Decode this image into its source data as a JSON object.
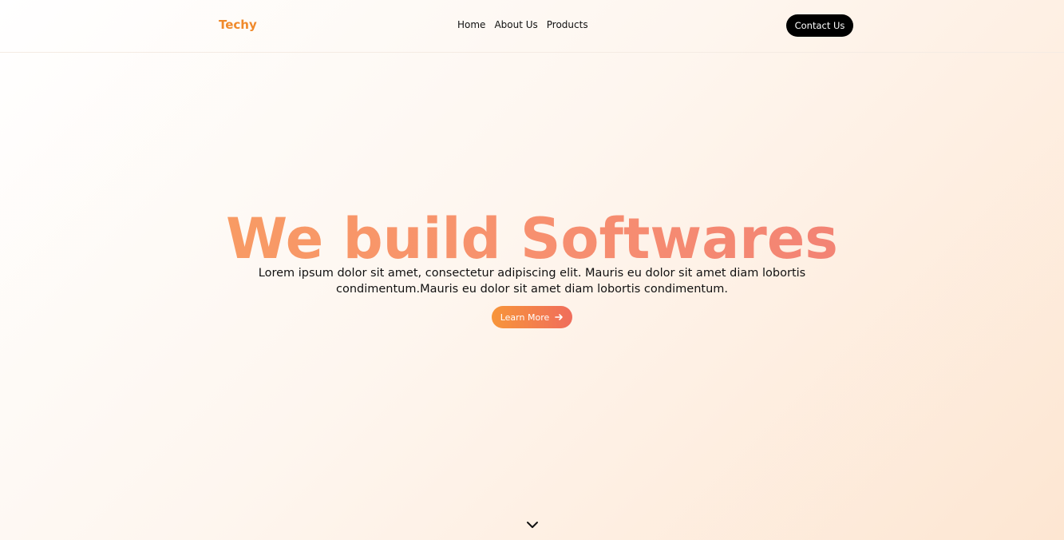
{
  "header": {
    "brand": "Techy",
    "nav": [
      {
        "label": "Home"
      },
      {
        "label": "About Us"
      },
      {
        "label": "Products"
      }
    ],
    "contact_label": "Contact Us"
  },
  "hero": {
    "title": "We build Softwares",
    "subtitle": "Lorem ipsum dolor sit amet, consectetur adipiscing elit. Mauris eu dolor sit amet diam lobortis condimentum.Mauris eu dolor sit amet diam lobortis condimentum.",
    "cta_label": "Learn More",
    "cta_icon": "arrow-right-icon"
  },
  "scroll": {
    "icon": "chevron-down-icon"
  },
  "colors": {
    "brand": "#f08a2c",
    "title_gradient_start": "#f9a35c",
    "title_gradient_end": "#f07a78",
    "cta_gradient_start": "#f7953a",
    "cta_gradient_end": "#f06d5c",
    "contact_bg": "#000000"
  }
}
